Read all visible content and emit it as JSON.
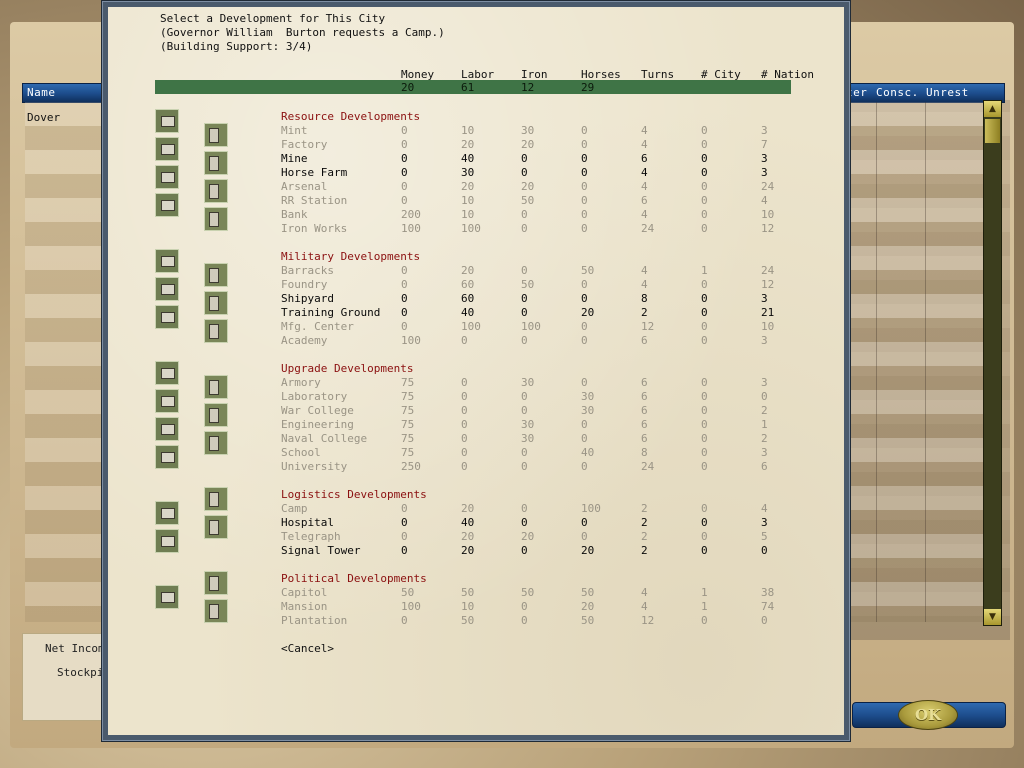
{
  "dialog": {
    "title": "Select a Development for This City",
    "request": "(Governor William  Burton requests a Camp.)",
    "support": "(Building Support: 3/4)",
    "columns": [
      "Money",
      "Labor",
      "Iron",
      "Horses",
      "Turns",
      "# City",
      "# Nation"
    ],
    "totals": [
      "20",
      "61",
      "12",
      "29"
    ],
    "cancel_label": "<Cancel>",
    "sections": [
      {
        "title": "Resource Developments",
        "rows": [
          {
            "name": "Mint",
            "money": "0",
            "labor": "10",
            "iron": "30",
            "horses": "0",
            "turns": "4",
            "city": "0",
            "nation": "3",
            "available": false
          },
          {
            "name": "Factory",
            "money": "0",
            "labor": "20",
            "iron": "20",
            "horses": "0",
            "turns": "4",
            "city": "0",
            "nation": "7",
            "available": false
          },
          {
            "name": "Mine",
            "money": "0",
            "labor": "40",
            "iron": "0",
            "horses": "0",
            "turns": "6",
            "city": "0",
            "nation": "3",
            "available": true
          },
          {
            "name": "Horse Farm",
            "money": "0",
            "labor": "30",
            "iron": "0",
            "horses": "0",
            "turns": "4",
            "city": "0",
            "nation": "3",
            "available": true
          },
          {
            "name": "Arsenal",
            "money": "0",
            "labor": "20",
            "iron": "20",
            "horses": "0",
            "turns": "4",
            "city": "0",
            "nation": "24",
            "available": false
          },
          {
            "name": "RR Station",
            "money": "0",
            "labor": "10",
            "iron": "50",
            "horses": "0",
            "turns": "6",
            "city": "0",
            "nation": "4",
            "available": false
          },
          {
            "name": "Bank",
            "money": "200",
            "labor": "10",
            "iron": "0",
            "horses": "0",
            "turns": "4",
            "city": "0",
            "nation": "10",
            "available": false
          },
          {
            "name": "Iron Works",
            "money": "100",
            "labor": "100",
            "iron": "0",
            "horses": "0",
            "turns": "24",
            "city": "0",
            "nation": "12",
            "available": false
          }
        ]
      },
      {
        "title": "Military Developments",
        "rows": [
          {
            "name": "Barracks",
            "money": "0",
            "labor": "20",
            "iron": "0",
            "horses": "50",
            "turns": "4",
            "city": "1",
            "nation": "24",
            "available": false
          },
          {
            "name": "Foundry",
            "money": "0",
            "labor": "60",
            "iron": "50",
            "horses": "0",
            "turns": "4",
            "city": "0",
            "nation": "12",
            "available": false
          },
          {
            "name": "Shipyard",
            "money": "0",
            "labor": "60",
            "iron": "0",
            "horses": "0",
            "turns": "8",
            "city": "0",
            "nation": "3",
            "available": true
          },
          {
            "name": "Training Ground",
            "money": "0",
            "labor": "40",
            "iron": "0",
            "horses": "20",
            "turns": "2",
            "city": "0",
            "nation": "21",
            "available": true
          },
          {
            "name": "Mfg. Center",
            "money": "0",
            "labor": "100",
            "iron": "100",
            "horses": "0",
            "turns": "12",
            "city": "0",
            "nation": "10",
            "available": false
          },
          {
            "name": "Academy",
            "money": "100",
            "labor": "0",
            "iron": "0",
            "horses": "0",
            "turns": "6",
            "city": "0",
            "nation": "3",
            "available": false
          }
        ]
      },
      {
        "title": "Upgrade Developments",
        "rows": [
          {
            "name": "Armory",
            "money": "75",
            "labor": "0",
            "iron": "30",
            "horses": "0",
            "turns": "6",
            "city": "0",
            "nation": "3",
            "available": false
          },
          {
            "name": "Laboratory",
            "money": "75",
            "labor": "0",
            "iron": "0",
            "horses": "30",
            "turns": "6",
            "city": "0",
            "nation": "0",
            "available": false
          },
          {
            "name": "War College",
            "money": "75",
            "labor": "0",
            "iron": "0",
            "horses": "30",
            "turns": "6",
            "city": "0",
            "nation": "2",
            "available": false
          },
          {
            "name": "Engineering",
            "money": "75",
            "labor": "0",
            "iron": "30",
            "horses": "0",
            "turns": "6",
            "city": "0",
            "nation": "1",
            "available": false
          },
          {
            "name": "Naval College",
            "money": "75",
            "labor": "0",
            "iron": "30",
            "horses": "0",
            "turns": "6",
            "city": "0",
            "nation": "2",
            "available": false
          },
          {
            "name": "School",
            "money": "75",
            "labor": "0",
            "iron": "0",
            "horses": "40",
            "turns": "8",
            "city": "0",
            "nation": "3",
            "available": false
          },
          {
            "name": "University",
            "money": "250",
            "labor": "0",
            "iron": "0",
            "horses": "0",
            "turns": "24",
            "city": "0",
            "nation": "6",
            "available": false
          }
        ]
      },
      {
        "title": "Logistics Developments",
        "rows": [
          {
            "name": "Camp",
            "money": "0",
            "labor": "20",
            "iron": "0",
            "horses": "100",
            "turns": "2",
            "city": "0",
            "nation": "4",
            "available": false
          },
          {
            "name": "Hospital",
            "money": "0",
            "labor": "40",
            "iron": "0",
            "horses": "0",
            "turns": "2",
            "city": "0",
            "nation": "3",
            "available": true
          },
          {
            "name": "Telegraph",
            "money": "0",
            "labor": "20",
            "iron": "20",
            "horses": "0",
            "turns": "2",
            "city": "0",
            "nation": "5",
            "available": false
          },
          {
            "name": "Signal Tower",
            "money": "0",
            "labor": "20",
            "iron": "0",
            "horses": "20",
            "turns": "2",
            "city": "0",
            "nation": "0",
            "available": true
          }
        ]
      },
      {
        "title": "Political Developments",
        "rows": [
          {
            "name": "Capitol",
            "money": "50",
            "labor": "50",
            "iron": "50",
            "horses": "50",
            "turns": "4",
            "city": "1",
            "nation": "38",
            "available": false
          },
          {
            "name": "Mansion",
            "money": "100",
            "labor": "10",
            "iron": "0",
            "horses": "20",
            "turns": "4",
            "city": "1",
            "nation": "74",
            "available": false
          },
          {
            "name": "Plantation",
            "money": "0",
            "labor": "50",
            "iron": "0",
            "horses": "50",
            "turns": "12",
            "city": "0",
            "nation": "0",
            "available": false
          }
        ]
      }
    ]
  },
  "background": {
    "left_header": "Name",
    "right_headers": [
      "ter",
      "Consc.",
      "Unrest"
    ],
    "city_name": "Dover",
    "net_income_label": "Net Income",
    "stockpile_label": "Stockpile",
    "ok_label": "OK"
  },
  "colors": {
    "section_title": "#8b1010",
    "totals_bar": "#3f7446",
    "available_text": "#0a0a0a",
    "unavailable_text": "#9a9485",
    "header_bar_blue": "#1c4b8a"
  }
}
